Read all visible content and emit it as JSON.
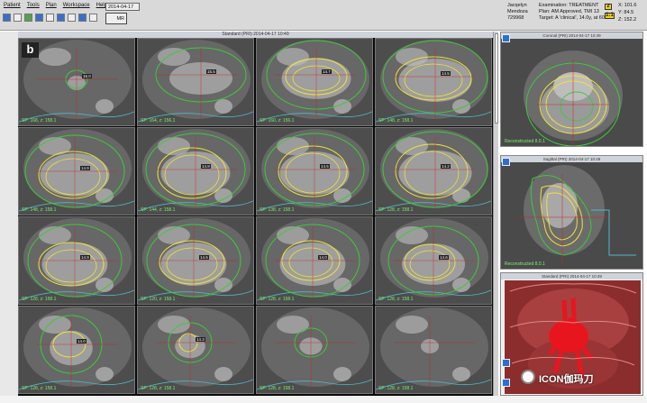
{
  "menu": [
    "Patient",
    "Tools",
    "Plan",
    "Workspace",
    "Help"
  ],
  "date_field": "2014-04-17",
  "mr_button": "MR",
  "patient": {
    "name1": "Jacqelyn",
    "name2": "Mendoza",
    "id": "729968"
  },
  "exam": {
    "line1": "Examination: TREATMENT",
    "line2": "Plan: AM Approved, TMI 13",
    "line3": "Target: A 'clinical', 14.0y, at 60%"
  },
  "coords": {
    "x": "X: 101.6",
    "y": "Y: 84.5",
    "z": "Z: 152.2"
  },
  "controls": [
    "z",
    "1:1"
  ],
  "main_title": "Standard (PRI) 2014-04-17 10:49",
  "panel_letter": "b",
  "cells": [
    {
      "sp": "SP: 168, z: 158.1",
      "label": "16.0"
    },
    {
      "sp": "SP: 164, z: 156.1",
      "label": "15.5"
    },
    {
      "sp": "SP: 160, z: 156.1",
      "label": "14.7"
    },
    {
      "sp": "SP: 148, z: 158.1",
      "label": "14.5"
    },
    {
      "sp": "SP: 148, z: 158.1",
      "label": "14.9"
    },
    {
      "sp": "SP: 144, z: 158.1",
      "label": "14.8"
    },
    {
      "sp": "SP: 138, z: 158.1",
      "label": "14.5"
    },
    {
      "sp": "SP: 128, z: 158.1",
      "label": "14.2"
    },
    {
      "sp": "SP: 128, z: 158.1",
      "label": "14.9"
    },
    {
      "sp": "SP: 120, z: 158.1",
      "label": "14.6"
    },
    {
      "sp": "SP: 128, z: 158.1",
      "label": "14.0"
    },
    {
      "sp": "SP: 128, z: 158.1",
      "label": "14.6"
    },
    {
      "sp": "SP: 128, z: 158.1",
      "label": "14.0"
    },
    {
      "sp": "SP: 128, z: 158.1",
      "label": "14.3"
    },
    {
      "sp": "SP: 128, z: 158.1",
      "label": ""
    },
    {
      "sp": "SP: 128, z: 158.1",
      "label": ""
    }
  ],
  "side_views": [
    {
      "title": "Coronal (PRI) 2014-04-17 10:49",
      "label": "Reconstructed 8.0.1"
    },
    {
      "title": "Sagittal (PRI) 2014-04-17 10:49",
      "label": "Reconstructed 8.0.1"
    },
    {
      "title": "Standard (PRI) 2014-04-17 10:49",
      "label": ""
    }
  ],
  "watermark": "ICON伽玛刀",
  "colors": {
    "contour_green": "#3ec93a",
    "contour_yellow": "#f2e233",
    "contour_cyan": "#4fb8c9",
    "label_green": "#7cf06c",
    "toolbar_blue": "#3a6fc9"
  }
}
